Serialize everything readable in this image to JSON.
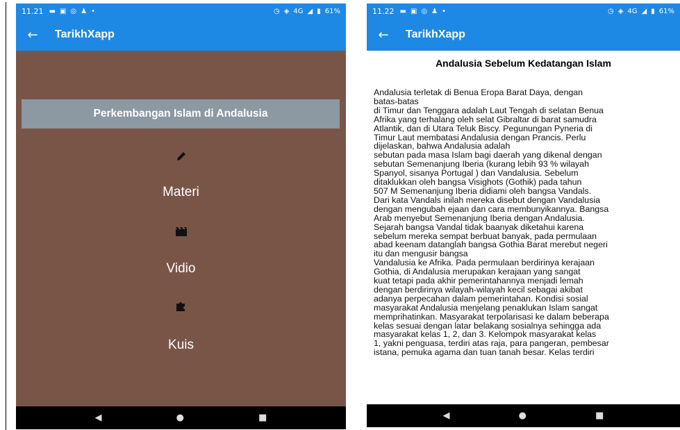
{
  "screens": {
    "left": {
      "status": {
        "time": "11.21",
        "battery": "61%",
        "network": "4G"
      },
      "app_title": "TarikhXapp",
      "banner": "Perkembangan Islam di Andalusia",
      "menu": [
        {
          "icon": "pencil-icon",
          "label": "Materi"
        },
        {
          "icon": "film-icon",
          "label": "Vidio"
        },
        {
          "icon": "puzzle-icon",
          "label": "Kuis"
        }
      ]
    },
    "right": {
      "status": {
        "time": "11.22",
        "battery": "61%",
        "network": "4G"
      },
      "app_title": "TarikhXapp",
      "article_title": "Andalusia Sebelum Kedatangan Islam",
      "article_body": "Andalusia terletak di Benua Eropa Barat Daya, dengan\nbatas-batas\ndi Timur dan Tenggara adalah Laut Tengah di selatan Benua\nAfrika yang terhalang oleh selat Gibraltar di barat samudra\nAtlantik, dan di Utara Teluk Biscy. Pegunungan Pyneria di\nTimur Laut membatasi Andalusia dengan Prancis. Perlu\ndijelaskan, bahwa Andalusia adalah\nsebutan pada masa Islam bagi daerah yang dikenal dengan\nsebutan Semenanjung Iberia (kurang lebih 93 % wilayah\nSpanyol, sisanya Portugal ) dan Vandalusia. Sebelum\nditaklukkan oleh bangsa Visighots (Gothik) pada tahun\n507 M Semenanjung Iberia didiami oleh bangsa Vandals.\nDari kata Vandals inilah mereka disebut dengan Vandalusia\ndengan mengubah ejaan dan cara membunyikannya. Bangsa\nArab menyebut Semenanjung Iberia dengan Andalusia.\nSejarah bangsa Vandal tidak baanyak diketahui karena\nsebelum mereka sempat berbuat banyak, pada permulaan\nabad keenam datanglah  bangsa Gothia Barat merebut negeri\nitu dan mengusir bangsa\nVandalusia ke Afrika. Pada permulaan berdirinya kerajaan\nGothia, di Andalusia merupakan kerajaan yang sangat\nkuat tetapi pada akhir pemerintahannya menjadi lemah\ndengan berdirinya wilayah-wilayah kecil sebagai akibat\nadanya perpecahan dalam pemerintahan. Kondisi sosial\nmasyarakat Andalusia menjelang penaklukan Islam sangat\nmemprihatinkan. Masyarakat terpolarisasi ke dalam beberapa\nkelas sesuai dengan latar belakang sosialnya sehingga ada\nmasyarakat  kelas 1, 2, dan 3. Kelompok masyarakat kelas\n1, yakni penguasa, terdiri atas raja, para pangeran, pembesar\nistana, pemuka agama dan tuan tanah besar. Kelas terdiri"
    }
  },
  "colors": {
    "appbar": "#1e88e5",
    "menu_bg": "#795548",
    "banner_bg": "#8c98a2"
  }
}
